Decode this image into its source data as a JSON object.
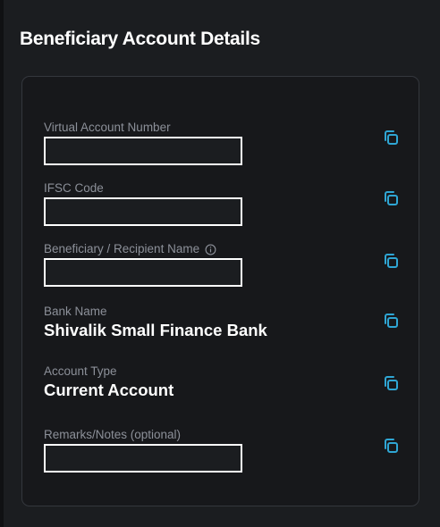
{
  "header": {
    "title": "Beneficiary Account Details"
  },
  "fields": [
    {
      "label": "Virtual Account Number",
      "value": "",
      "copy_icon": "copy-icon"
    },
    {
      "label": "IFSC Code",
      "value": "",
      "copy_icon": "copy-icon"
    },
    {
      "label": "Beneficiary / Recipient Name",
      "value": "",
      "copy_icon": "copy-icon",
      "info_icon": "info-icon"
    },
    {
      "label": "Bank Name",
      "value": "Shivalik Small Finance Bank",
      "copy_icon": "copy-icon"
    },
    {
      "label": "Account Type",
      "value": "Current Account",
      "copy_icon": "copy-icon"
    },
    {
      "label": "Remarks/Notes (optional)",
      "value": "",
      "copy_icon": "copy-icon"
    }
  ],
  "colors": {
    "background": "#1b1d20",
    "card_border": "#34373d",
    "accent": "#2fa6d4",
    "label": "#8c9099",
    "value": "#ffffff"
  }
}
